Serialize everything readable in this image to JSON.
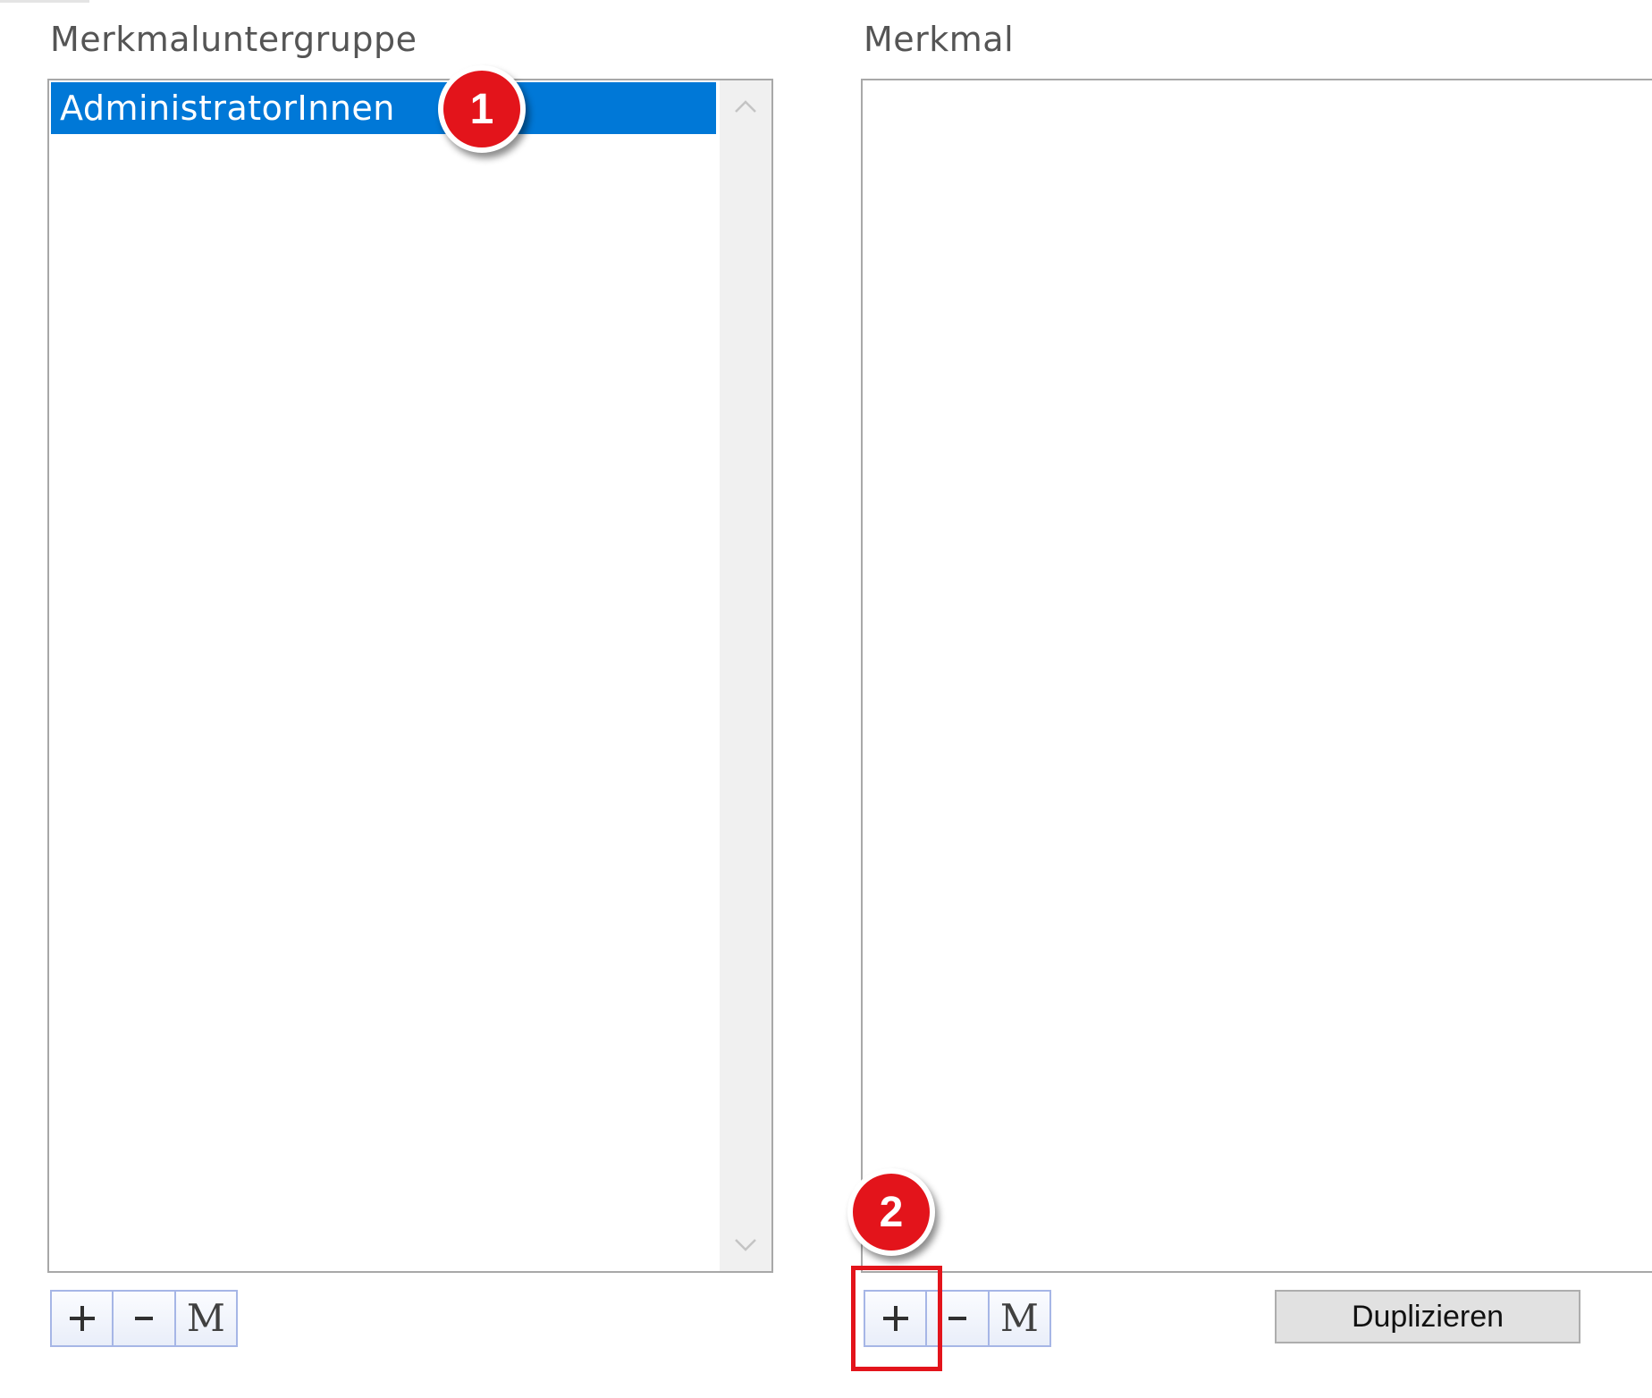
{
  "left_panel": {
    "label": "Merkmaluntergruppe",
    "items": [
      {
        "label": "AdministratorInnen",
        "selected": true
      }
    ],
    "toolbar": {
      "add_icon": "plus-icon",
      "remove_icon": "minus-icon",
      "m_label": "M"
    }
  },
  "right_panel": {
    "label": "Merkmal",
    "items": [],
    "toolbar": {
      "add_icon": "plus-icon",
      "remove_icon": "minus-icon",
      "m_label": "M"
    },
    "duplicate_label": "Duplizieren"
  },
  "annotations": {
    "badge_1": "1",
    "badge_2": "2"
  },
  "colors": {
    "selection": "#0078d7",
    "annotation_red": "#e3141b",
    "button_border": "#a6b6e6"
  }
}
